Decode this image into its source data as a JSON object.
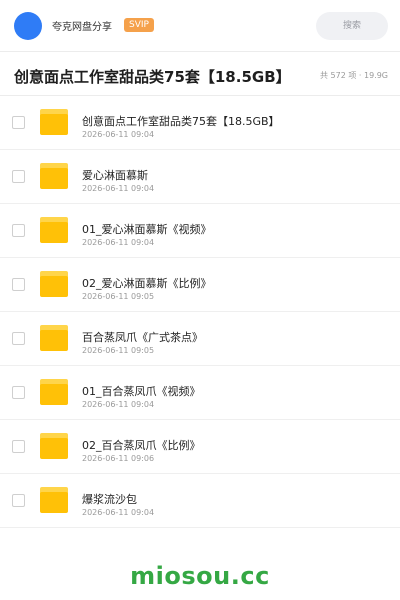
{
  "header": {
    "brand": "夸克网盘分享",
    "badge": "SVIP",
    "search_placeholder": "搜索"
  },
  "share": {
    "title": "创意面点工作室甜品类75套【18.5GB】",
    "meta": "共 572 项 · 19.9G"
  },
  "items": [
    {
      "name": "创意面点工作室甜品类75套【18.5GB】",
      "date": "2026-06-11 09:04",
      "icon": "folder-icon"
    },
    {
      "name": "爱心淋面慕斯",
      "date": "2026-06-11 09:04",
      "icon": "folder-icon"
    },
    {
      "name": "01_爱心淋面慕斯《视频》",
      "date": "2026-06-11 09:04",
      "icon": "folder-icon"
    },
    {
      "name": "02_爱心淋面慕斯《比例》",
      "date": "2026-06-11 09:05",
      "icon": "folder-icon"
    },
    {
      "name": "百合蒸凤爪《广式茶点》",
      "date": "2026-06-11 09:05",
      "icon": "folder-icon"
    },
    {
      "name": "01_百合蒸凤爪《视频》",
      "date": "2026-06-11 09:04",
      "icon": "folder-icon"
    },
    {
      "name": "02_百合蒸凤爪《比例》",
      "date": "2026-06-11 09:06",
      "icon": "folder-icon"
    },
    {
      "name": "爆浆流沙包",
      "date": "2026-06-11 09:04",
      "icon": "folder-icon"
    }
  ],
  "watermark": "miosou.cc",
  "colors": {
    "accent_blue": "#2f7cf6",
    "svip_orange": "#f5a14b",
    "folder_yellow": "#ffc107",
    "watermark_green": "#35a844"
  }
}
